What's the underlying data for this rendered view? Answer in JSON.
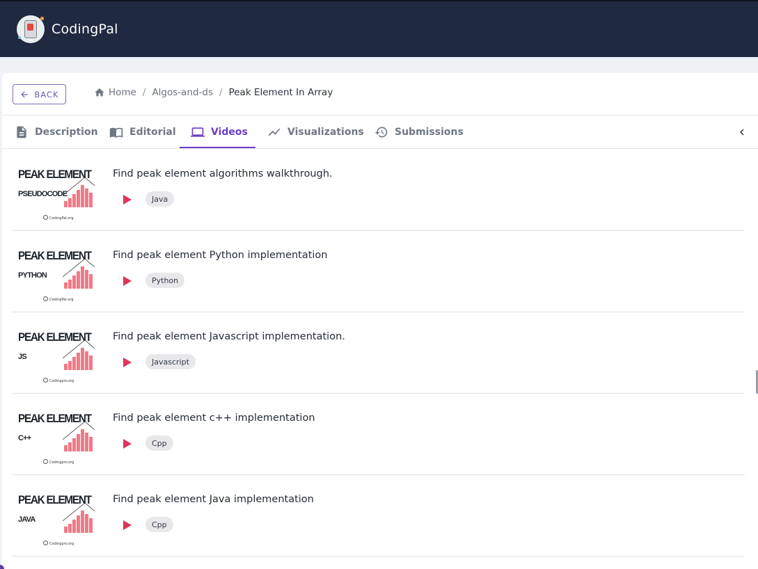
{
  "app": {
    "brand": "CodingPal"
  },
  "nav": {
    "back_label": "BACK",
    "breadcrumb": {
      "home": "Home",
      "section": "Algos-and-ds",
      "current": "Peak Element In Array"
    }
  },
  "tabs": [
    {
      "label": "Description",
      "icon": "document-icon"
    },
    {
      "label": "Editorial",
      "icon": "book-icon"
    },
    {
      "label": "Videos",
      "icon": "laptop-icon",
      "active": true
    },
    {
      "label": "Visualizations",
      "icon": "trend-line-icon"
    },
    {
      "label": "Submissions",
      "icon": "history-icon"
    }
  ],
  "videos": [
    {
      "title": "Find peak element algorithms walkthrough.",
      "tag": "Java",
      "thumb_title": "PEAK ELEMENT",
      "thumb_sub": "PSEUDOCODE",
      "thumb_site": "CodingPal.org"
    },
    {
      "title": "Find peak element Python implementation",
      "tag": "Python",
      "thumb_title": "PEAK ELEMENT",
      "thumb_sub": "PYTHON",
      "thumb_site": "CodingPal.org"
    },
    {
      "title": "Find peak element Javascript implementation.",
      "tag": "Javascript",
      "thumb_title": "PEAK ELEMENT",
      "thumb_sub": "JS",
      "thumb_site": "Codingpro.org"
    },
    {
      "title": "Find peak element c++ implementation",
      "tag": "Cpp",
      "thumb_title": "PEAK ELEMENT",
      "thumb_sub": "C++",
      "thumb_site": "Codingpro.org"
    },
    {
      "title": "Find peak element Java implementation",
      "tag": "Cpp",
      "thumb_title": "PEAK ELEMENT",
      "thumb_sub": "JAVA",
      "thumb_site": "Codingpro.org"
    }
  ],
  "colors": {
    "header_bg": "#1f2940",
    "accent": "#6a3fc2",
    "play": "#e0345a",
    "bars": "#f07a86"
  }
}
